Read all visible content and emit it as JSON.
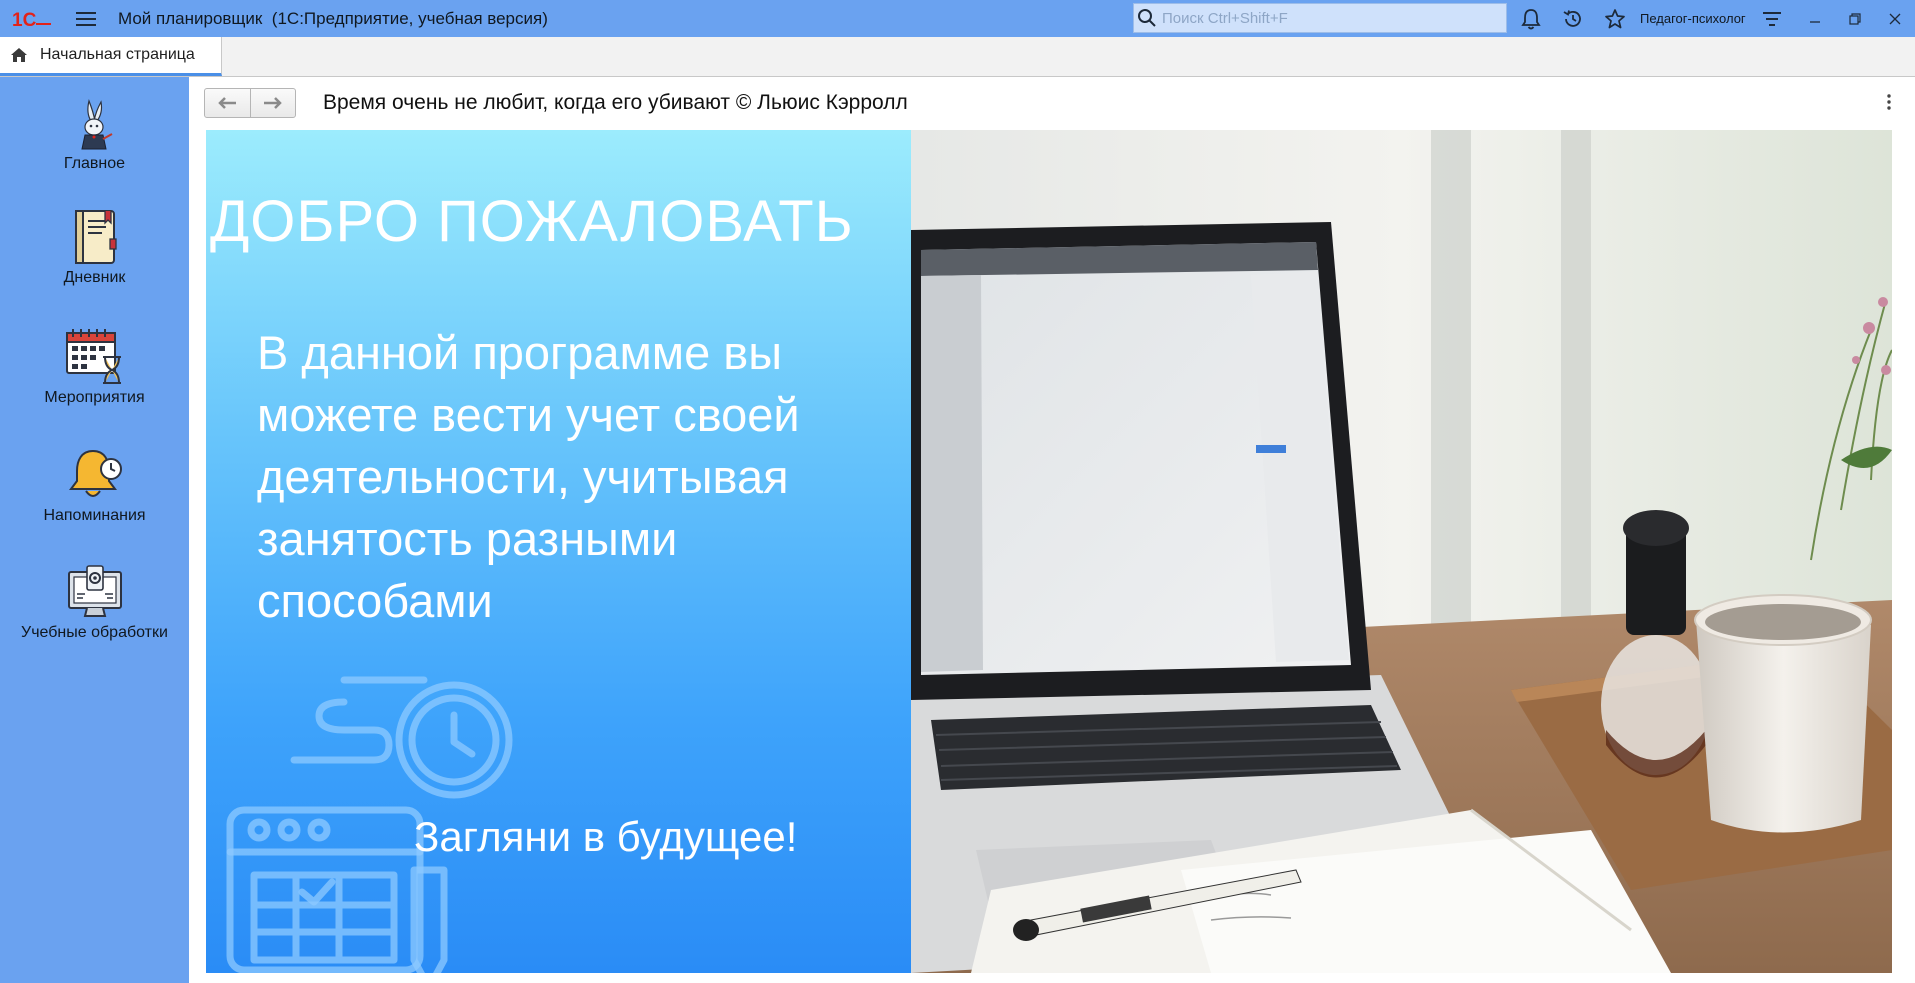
{
  "titlebar": {
    "logo": "1С",
    "app_title": "Мой планировщик  (1С:Предприятие, учебная версия)",
    "search_placeholder": "Поиск Ctrl+Shift+F",
    "user_name": "Педагог-психолог",
    "icons": [
      "logo-1c-icon",
      "menu-icon",
      "search-icon",
      "bell-icon",
      "history-icon",
      "star-icon",
      "user-menu-icon",
      "minimize-icon",
      "restore-icon",
      "close-icon"
    ]
  },
  "tabs": [
    {
      "label": "Начальная страница",
      "icon": "home-icon"
    }
  ],
  "sidebar": {
    "items": [
      {
        "label": "Главное",
        "icon": "rabbit-icon"
      },
      {
        "label": "Дневник",
        "icon": "diary-icon"
      },
      {
        "label": "Мероприятия",
        "icon": "calendar-icon"
      },
      {
        "label": "Напоминания",
        "icon": "bell-reminder-icon"
      },
      {
        "label": "Учебные обработки",
        "icon": "computer-settings-icon"
      }
    ]
  },
  "main": {
    "title": "Время очень не любит, когда его убивают © Льюис Кэрролл",
    "banner": {
      "welcome": "ДОБРО ПОЖАЛОВАТЬ",
      "description": "В данной программе вы можете вести учет своей деятельности, учитывая занятость разными способами",
      "call_to_action": "Загляни в будущее!"
    }
  },
  "colors": {
    "accent": "#6aa2f0",
    "banner_top": "#9cecfd",
    "banner_bottom": "#2a8cf6"
  }
}
